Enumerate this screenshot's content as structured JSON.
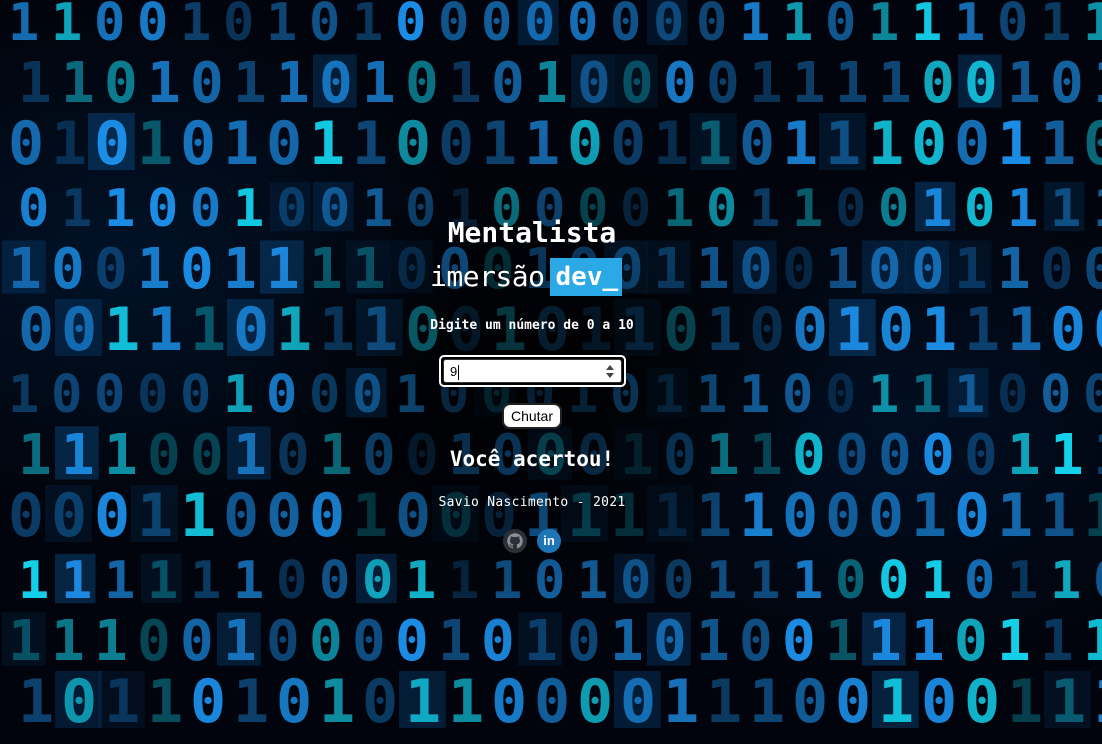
{
  "page": {
    "title": "Mentalista",
    "brand_light": "imersão",
    "brand_box": "dev_",
    "prompt": "Digite um número de 0 a 10",
    "input_value": "9",
    "guess_button": "Chutar",
    "result": "Você acertou!",
    "footer": "Savio Nascimento - 2021",
    "social": {
      "github_icon": "github-icon",
      "linkedin_icon": "linkedin-icon",
      "linkedin_glyph": "in"
    }
  },
  "colors": {
    "accent": "#2aa9e6",
    "background": "#01040c",
    "digit_blue": "#1c8fe8",
    "digit_cyan": "#14d6f0",
    "text": "#ffffff"
  }
}
